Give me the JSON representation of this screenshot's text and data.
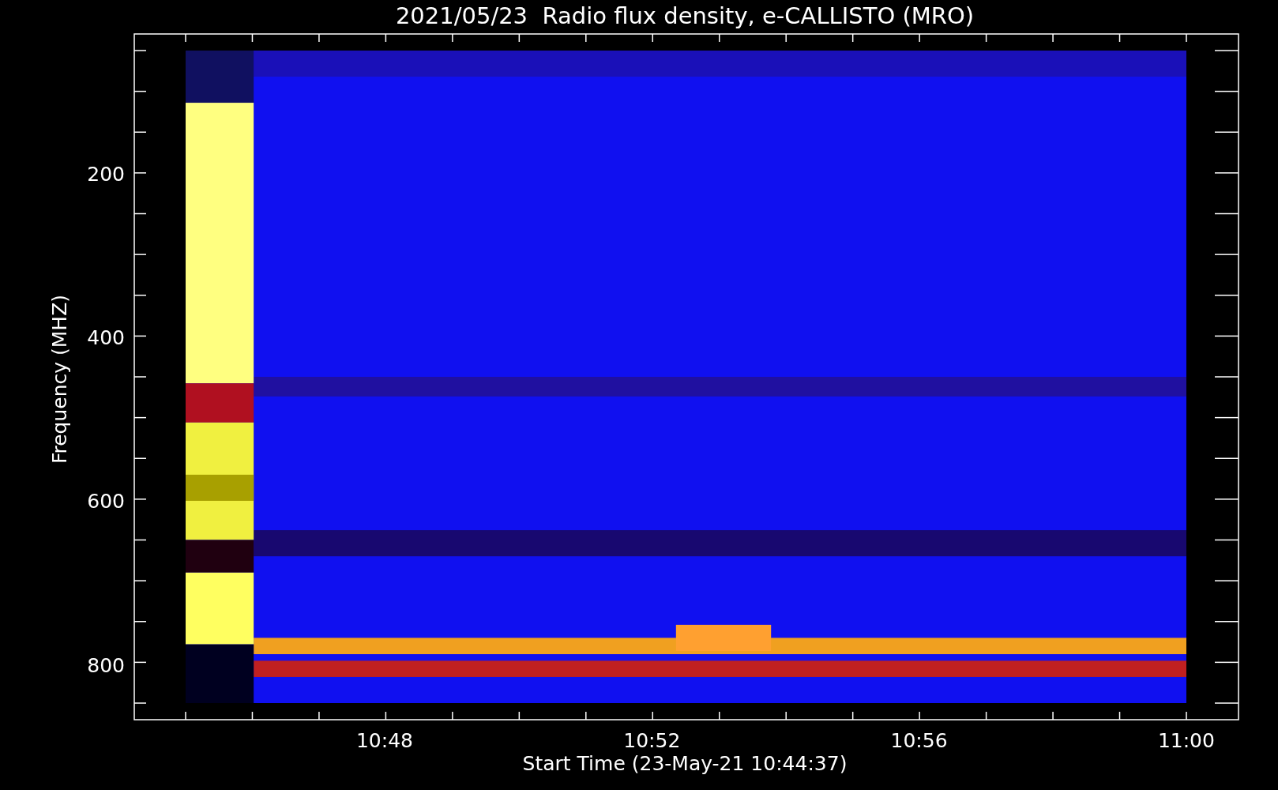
{
  "title": "2021/05/23  Radio flux density, e-CALLISTO (MRO)",
  "y_axis": {
    "label": "Frequency (MHZ)",
    "ticks": [
      "200",
      "400",
      "600",
      "800"
    ]
  },
  "x_axis": {
    "label": "Start Time (23-May-21 10:44:37)",
    "ticks": [
      "10:48",
      "10:52",
      "10:56",
      "11:00"
    ]
  }
}
